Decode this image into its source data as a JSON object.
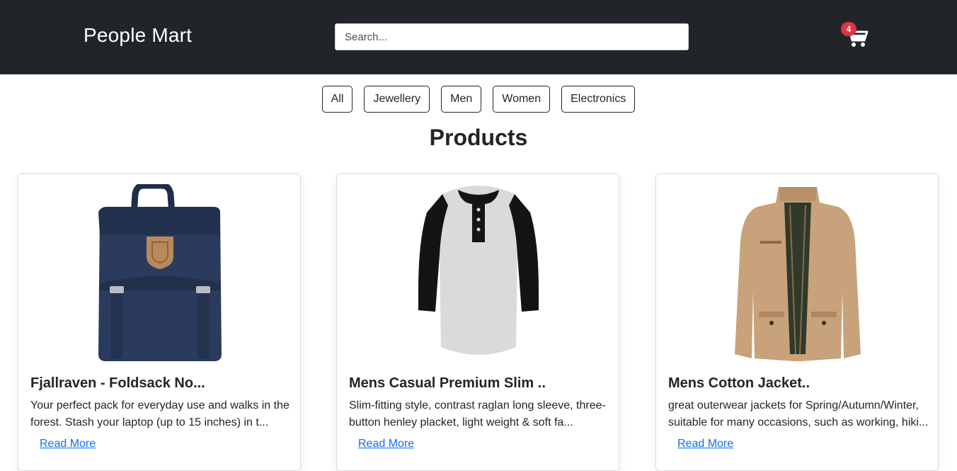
{
  "navbar": {
    "brand": "People Mart",
    "search_placeholder": "Search...",
    "search_value": "",
    "cart_count": "4",
    "cart_icon": "shopping-cart-icon"
  },
  "filters": [
    "All",
    "Jewellery",
    "Men",
    "Women",
    "Electronics"
  ],
  "page_title": "Products",
  "products": [
    {
      "title": "Fjallraven - Foldsack No...",
      "desc": "Your perfect pack for everyday use and walks in the forest. Stash your laptop (up to 15 inches) in t...",
      "link": "Read More",
      "image": "backpack-image"
    },
    {
      "title": "Mens Casual Premium Slim ..",
      "desc": "Slim-fitting style, contrast raglan long sleeve, three-button henley placket, light weight & soft fa...",
      "link": "Read More",
      "image": "raglan-tshirt-image"
    },
    {
      "title": "Mens Cotton Jacket..",
      "desc": "great outerwear jackets for Spring/Autumn/Winter, suitable for many occasions, such as working, hiki...",
      "link": "Read More",
      "image": "cotton-jacket-image"
    }
  ],
  "colors": {
    "navbar_bg": "#212529",
    "badge": "#dc3545",
    "link": "#0d6efd"
  }
}
